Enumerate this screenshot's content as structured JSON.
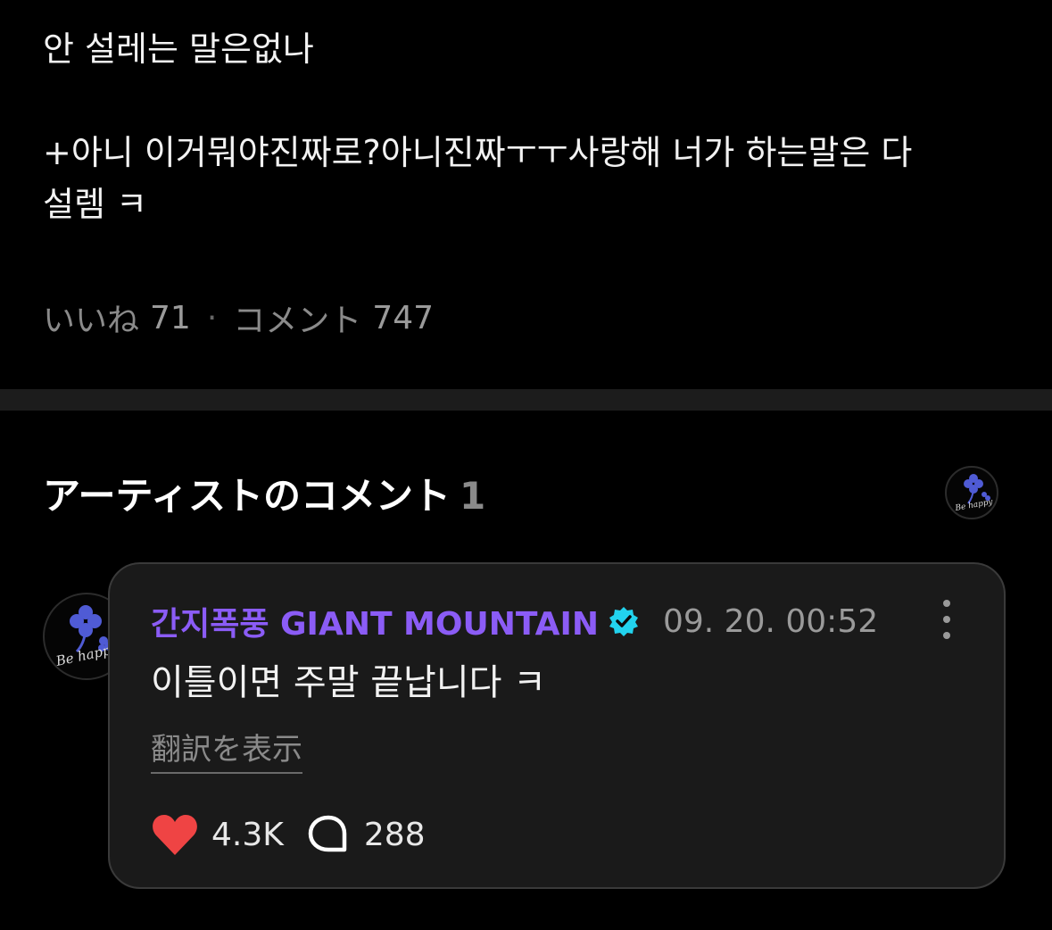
{
  "post": {
    "line1": "안 설레는 말은없나",
    "line2": "+아니 이거뭐야진짜로?아니진짜ㅜㅜ사랑해 너가 하는말은 다",
    "line3": "설렘 ㅋ",
    "likes_label": "いいね",
    "likes_count": "71",
    "separator": "·",
    "comments_label": "コメント",
    "comments_count": "747"
  },
  "artist_section": {
    "title": "アーティストのコメント",
    "count": "1"
  },
  "comment": {
    "author": "간지폭풍 GIANT MOUNTAIN",
    "verified": true,
    "timestamp": "09. 20. 00:52",
    "body": "이틀이면 주말 끝납니다 ㅋ",
    "translate_label": "翻訳を表示",
    "like_count": "4.3K",
    "reply_count": "288"
  },
  "avatar": {
    "logo_text": "Be happy"
  },
  "colors": {
    "background": "#000000",
    "card": "#1a1a1a",
    "author": "#8b5cf6",
    "verified": "#22d3ee",
    "like": "#ef4444"
  },
  "icons": [
    "verified-badge-icon",
    "more-vertical-icon",
    "heart-icon",
    "reply-bubble-icon",
    "clover-logo"
  ]
}
